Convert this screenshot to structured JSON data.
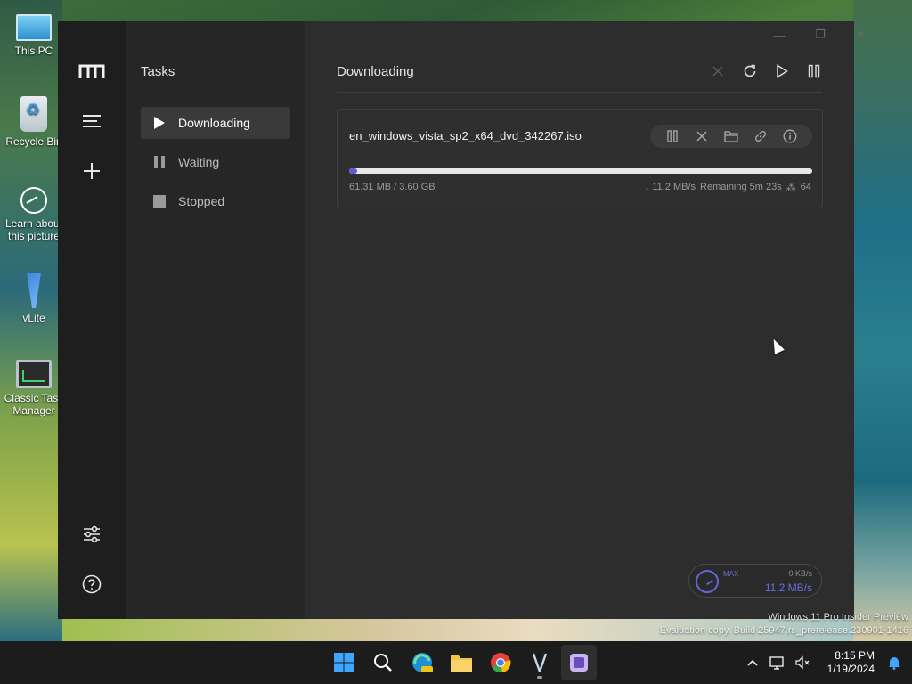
{
  "desktop": {
    "icons": [
      {
        "name": "desktop-icon-this-pc",
        "label": "This PC",
        "icon": "monitor-icon"
      },
      {
        "name": "desktop-icon-recycle-bin",
        "label": "Recycle Bin",
        "icon": "recycle-bin-icon"
      },
      {
        "name": "desktop-icon-learn-about-picture",
        "label": "Learn about this picture",
        "icon": "learn-picture-icon"
      },
      {
        "name": "desktop-icon-vlite",
        "label": "vLite",
        "icon": "vlite-icon"
      },
      {
        "name": "desktop-icon-classic-task-manager",
        "label": "Classic Task Manager",
        "icon": "task-manager-icon"
      }
    ],
    "watermark": {
      "line1": "Windows 11 Pro Insider Preview",
      "line2": "Evaluation copy. Build 25947.rs_prerelease.230901-1416"
    }
  },
  "window": {
    "controls": {
      "minimize": "—",
      "maximize": "❐",
      "close": "✕"
    }
  },
  "rail": {
    "logo_icon": "motrix-logo-icon",
    "items": [
      "menu-icon",
      "add-icon"
    ],
    "bottom": [
      "preferences-icon",
      "help-icon"
    ]
  },
  "tasks_panel": {
    "title": "Tasks",
    "items": [
      {
        "label": "Downloading",
        "icon": "play-icon",
        "active": true
      },
      {
        "label": "Waiting",
        "icon": "pause-icon",
        "active": false
      },
      {
        "label": "Stopped",
        "icon": "stop-icon",
        "active": false
      }
    ]
  },
  "main": {
    "title": "Downloading",
    "toolbar": [
      "clear-icon",
      "refresh-icon",
      "resume-all-icon",
      "pause-all-icon"
    ],
    "task": {
      "filename": "en_windows_vista_sp2_x64_dvd_342267.iso",
      "size": "61.31 MB / 3.60 GB",
      "progress_percent": 1.7,
      "speed": "↓ 11.2 MB/s",
      "remaining": "Remaining 5m 23s",
      "connections": "64",
      "actions": [
        "pause-icon",
        "delete-icon",
        "folder-icon",
        "link-icon",
        "info-icon"
      ]
    },
    "speedometer": {
      "max_label": "MAX",
      "upload": "0 KB/s",
      "download": "11.2 MB/s"
    }
  },
  "taskbar": {
    "apps": [
      "windows-start-icon",
      "search-icon",
      "edge-pre-icon",
      "file-explorer-icon",
      "chrome-icon",
      "vlite-icon",
      "motrix-taskbar-icon"
    ],
    "clock": {
      "time": "8:15 PM",
      "date": "1/19/2024"
    }
  },
  "colors": {
    "accent": "#5b5bd6",
    "window_bg": "#2d2d2d",
    "rail_bg": "#1e1e1e",
    "panel_bg": "#262626"
  }
}
